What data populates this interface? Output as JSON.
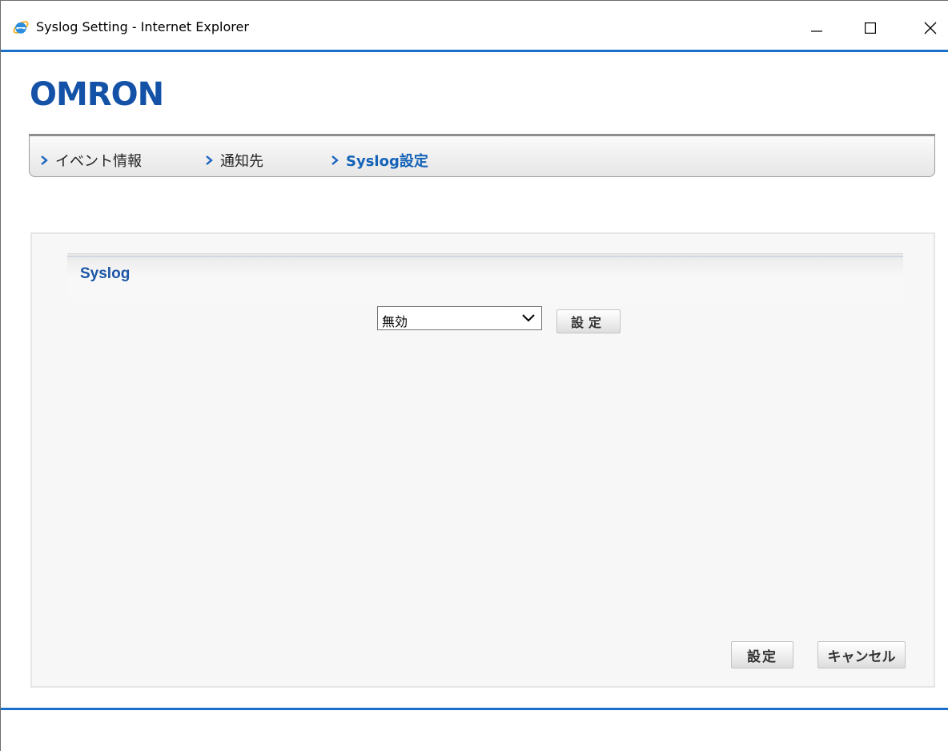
{
  "window": {
    "title": "Syslog Setting - Internet Explorer",
    "icons": {
      "app": "internet-explorer-icon",
      "minimize": "minimize-icon",
      "maximize": "maximize-icon",
      "close": "close-icon"
    }
  },
  "brand": {
    "logo_text": "OMRON",
    "color": "#1352a6"
  },
  "nav": {
    "items": [
      {
        "label": "イベント情報",
        "active": false
      },
      {
        "label": "通知先",
        "active": false
      },
      {
        "label": "Syslog設定",
        "active": true
      }
    ],
    "active_color": "#1463b8"
  },
  "syslog": {
    "title": "Syslog",
    "select_value": "無効",
    "set_button": "設定"
  },
  "footer": {
    "set_button": "設定",
    "cancel_button": "キャンセル"
  },
  "colors": {
    "accent_blue_line": "#1a6fc9",
    "section_title": "#1c56a6"
  }
}
